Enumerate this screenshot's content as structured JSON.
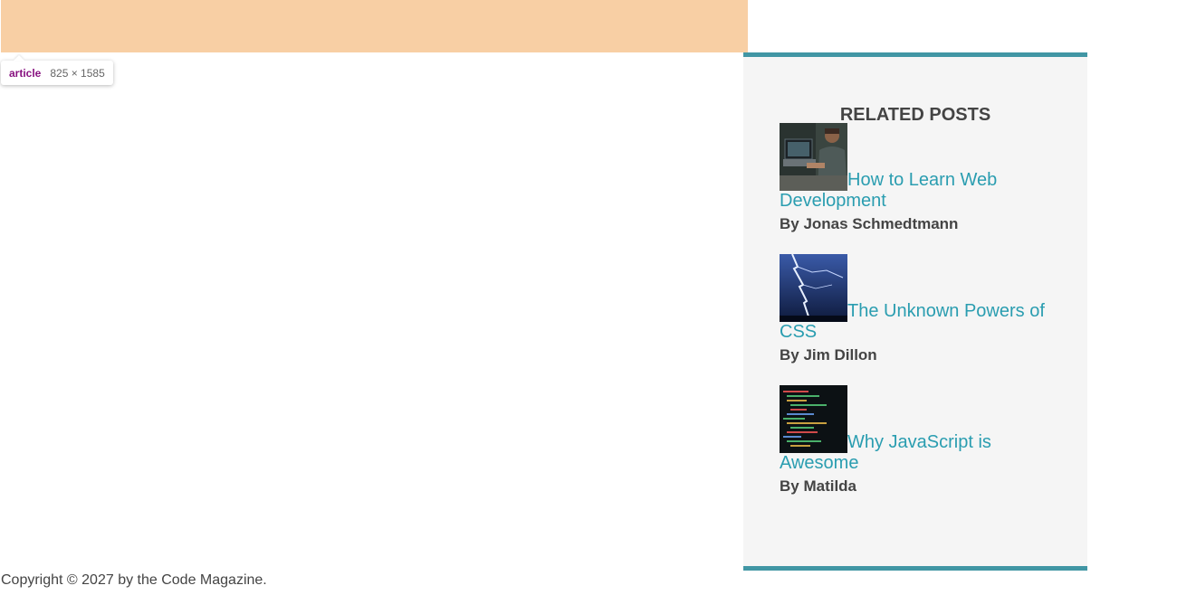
{
  "devtools_tooltip": {
    "tag": "article",
    "size": "825 × 1585"
  },
  "sidebar": {
    "title": "RELATED POSTS",
    "posts": [
      {
        "title": "How to Learn Web Development",
        "author": "By Jonas Schmedtmann",
        "thumbnail": "laptop-coder-photo"
      },
      {
        "title": "The Unknown Powers of CSS",
        "author": "By Jim Dillon",
        "thumbnail": "lightning-photo"
      },
      {
        "title": "Why JavaScript is Awesome",
        "author": "By Matilda",
        "thumbnail": "code-screen-photo"
      }
    ]
  },
  "footer": {
    "text": "Copyright © 2027 by the Code Magazine."
  },
  "colors": {
    "article_highlight": "#f8cfa4",
    "accent": "#4196a4",
    "link": "#2a9db0",
    "sidebar_bg": "#f5f5f5",
    "text": "#444444"
  }
}
